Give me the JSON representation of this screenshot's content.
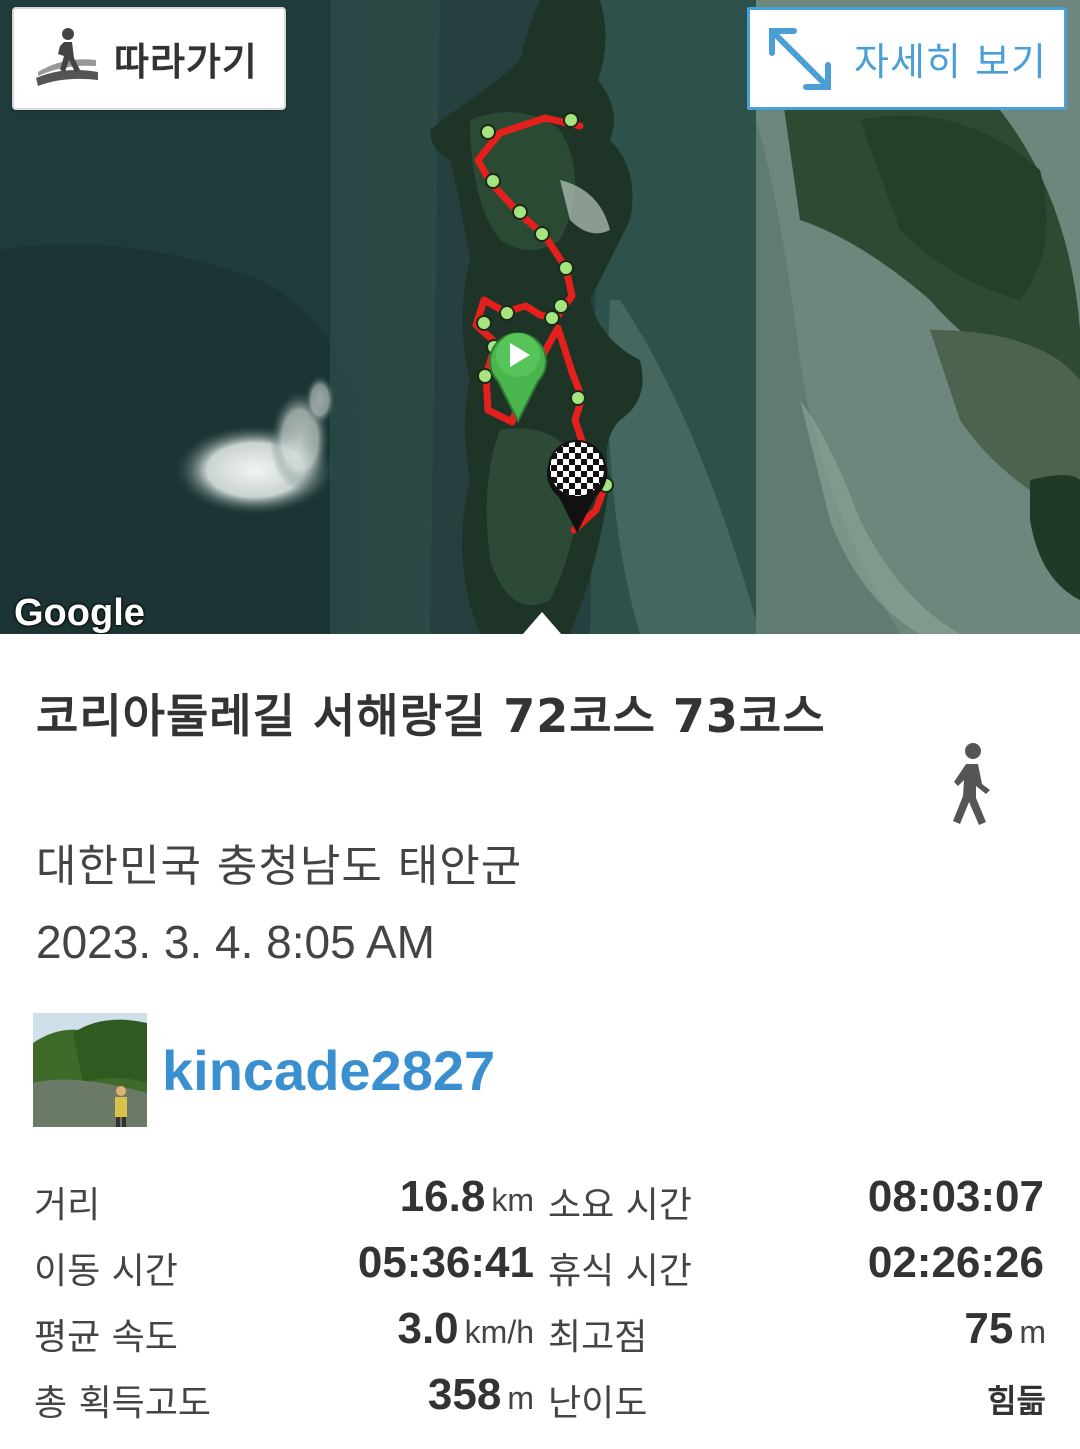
{
  "map": {
    "follow_button": {
      "label": "따라가기",
      "icon": "hiker-on-path-icon"
    },
    "detail_button": {
      "label": "자세히 보기",
      "icon": "expand-arrows-icon"
    },
    "attribution": "Google",
    "start_marker": "play-icon",
    "end_marker": "checkered-flag-icon",
    "route_color": "#e3201b",
    "waypoint_color": "#a6e47e"
  },
  "trip": {
    "title": "코리아둘레길 서해랑길 72코스 73코스",
    "activity_icon": "walking-person-icon",
    "location": "대한민국 충청남도 태안군",
    "datetime": "2023. 3. 4. 8:05 AM"
  },
  "user": {
    "name": "kincade2827",
    "accent": "#3a8fd0"
  },
  "stats": {
    "distance": {
      "label": "거리",
      "value": "16.8",
      "unit": "km"
    },
    "total_time": {
      "label": "소요 시간",
      "value": "08:03:07"
    },
    "moving_time": {
      "label": "이동 시간",
      "value": "05:36:41"
    },
    "rest_time": {
      "label": "휴식 시간",
      "value": "02:26:26"
    },
    "avg_speed": {
      "label": "평균 속도",
      "value": "3.0",
      "unit": "km/h"
    },
    "max_elevation": {
      "label": "최고점",
      "value": "75",
      "unit": "m"
    },
    "total_ascent": {
      "label": "총 획득고도",
      "value": "358",
      "unit": "m"
    },
    "difficulty": {
      "label": "난이도",
      "value": "힘듦"
    }
  }
}
